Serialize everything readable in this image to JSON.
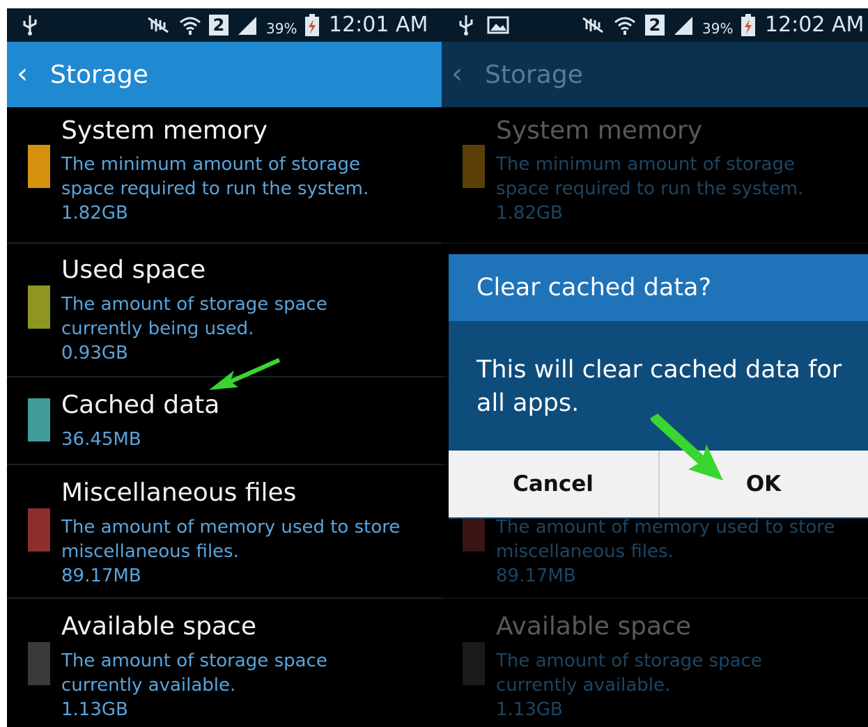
{
  "status_left": {
    "time": "12:01 AM",
    "battery": "39%",
    "sim": "2"
  },
  "status_right": {
    "time": "12:02 AM",
    "battery": "39%",
    "sim": "2"
  },
  "appbar": {
    "back_glyph": "‹",
    "title": "Storage"
  },
  "storage_items": [
    {
      "name": "System memory",
      "desc": [
        "The minimum amount of storage",
        "space required to run the system."
      ],
      "size": "1.82GB",
      "color": "#d4920f"
    },
    {
      "name": "Used space",
      "desc": [
        "The amount of storage space",
        "currently being used."
      ],
      "size": "0.93GB",
      "color": "#8e9620"
    },
    {
      "name": "Cached data",
      "desc": [],
      "size": "36.45MB",
      "color": "#3f9c98"
    },
    {
      "name": "Miscellaneous files",
      "desc": [
        "The amount of memory used to store",
        "miscellaneous files."
      ],
      "size": "89.17MB",
      "color": "#8e2f2e"
    },
    {
      "name": "Available space",
      "desc": [
        "The amount of storage space",
        "currently available."
      ],
      "size": "1.13GB",
      "color": "#3a3a3a"
    }
  ],
  "dialog": {
    "title": "Clear cached data?",
    "message": "This will clear cached data for all apps.",
    "cancel_label": "Cancel",
    "ok_label": "OK"
  },
  "colors": {
    "accent": "#1f89d1",
    "desc_text": "#5aa4dc",
    "arrow": "#39d531"
  }
}
